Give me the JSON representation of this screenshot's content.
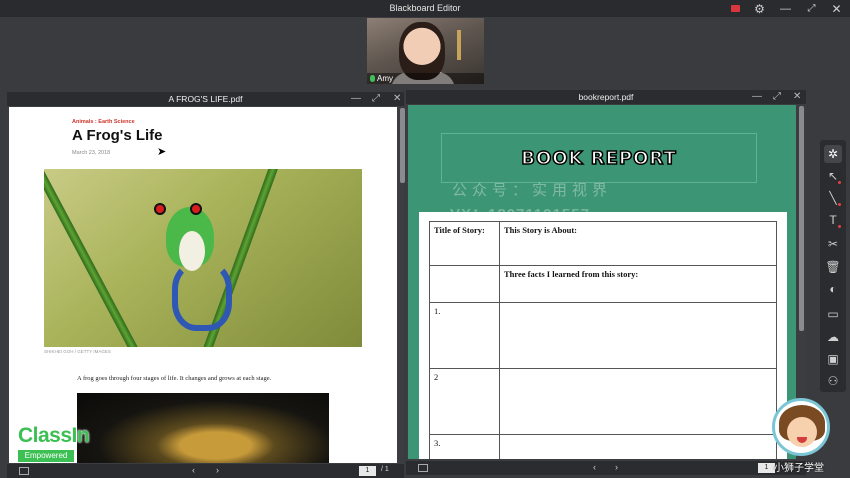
{
  "app": {
    "title": "Blackboard Editor"
  },
  "video": {
    "participant_name": "Amy"
  },
  "left_window": {
    "title": "A FROG'S LIFE.pdf",
    "page_current": "1",
    "page_total": "/ 1",
    "article": {
      "category": "Animals : Earth Science",
      "title": "A Frog's Life",
      "date": "March 23, 2018",
      "photo_credit": "SHIKHEI GOH / GETTY IMAGES",
      "body": "A frog goes through four stages of life. It changes and grows at each stage."
    }
  },
  "right_window": {
    "title": "bookreport.pdf",
    "page_current": "1",
    "report": {
      "heading": "BOOK REPORT",
      "watermark_line1": "公众号：实用视界",
      "watermark_line2": "VX：18071191557",
      "title_of_story": "Title of Story:",
      "story_about": "This Story is About:",
      "three_facts": "Three facts I learned from this story:",
      "row1": "1.",
      "row2": "2",
      "row3": "3."
    }
  },
  "branding": {
    "classin": "ClassIn",
    "empowered": "Empowered",
    "mascot_text": "小狮子学堂"
  },
  "colors": {
    "accent_green": "#3cbf53",
    "report_green": "#3c9574",
    "record_red": "#d9363e"
  },
  "icons": {
    "toolbar": [
      "cursor-icon",
      "select-icon",
      "pen-icon",
      "text-icon",
      "scissors-icon",
      "trash-icon",
      "laser-icon",
      "chat-icon",
      "cloud-icon",
      "toolbox-icon",
      "students-icon"
    ]
  }
}
